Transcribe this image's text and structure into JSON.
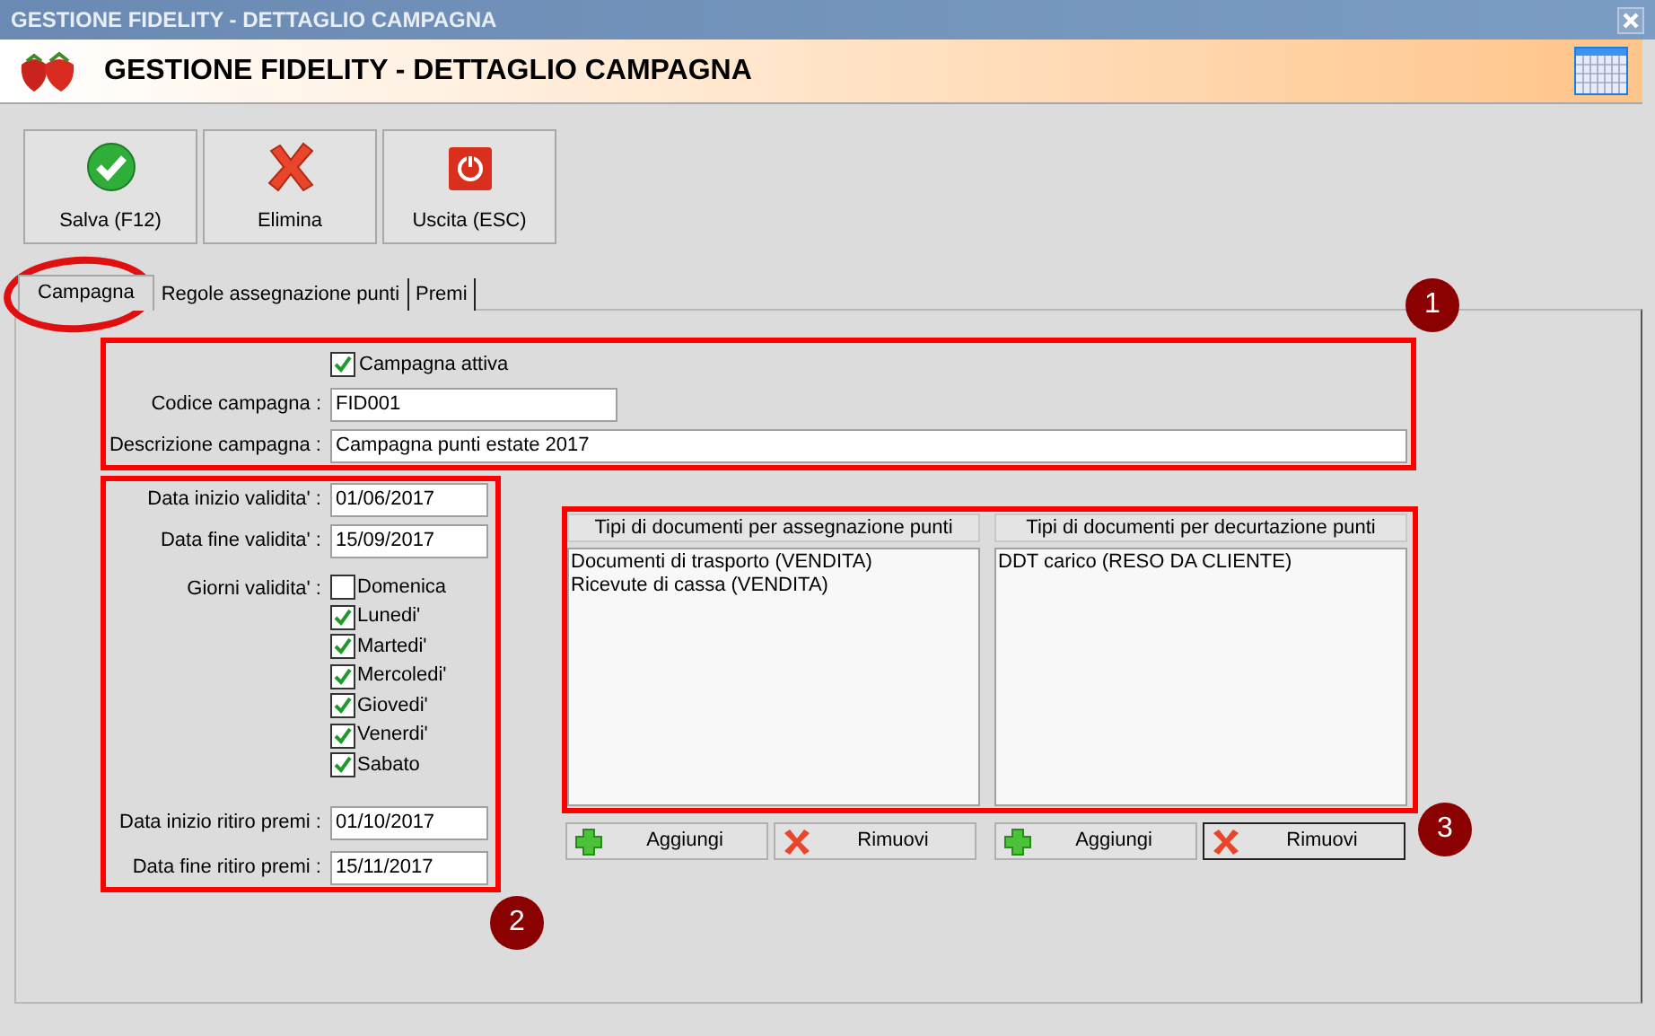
{
  "window": {
    "title": "GESTIONE FIDELITY - DETTAGLIO CAMPAGNA"
  },
  "header": {
    "title": "GESTIONE FIDELITY - DETTAGLIO CAMPAGNA"
  },
  "toolbar": [
    {
      "label": "Salva (F12)",
      "kind": "save"
    },
    {
      "label": "Elimina",
      "kind": "delete"
    },
    {
      "label": "Uscita (ESC)",
      "kind": "exit"
    }
  ],
  "tabs": [
    {
      "label": "Campagna",
      "selected": true
    },
    {
      "label": "Regole assegnazione punti",
      "selected": false
    },
    {
      "label": "Premi",
      "selected": false
    }
  ],
  "campaign": {
    "active": {
      "label": "Campagna attiva",
      "checked": true
    },
    "code": {
      "label": "Codice campagna :",
      "value": "FID001"
    },
    "description": {
      "label": "Descrizione campagna :",
      "value": "Campagna punti estate 2017"
    }
  },
  "validity": {
    "start": {
      "label": "Data inizio validita' :",
      "value": "01/06/2017"
    },
    "end": {
      "label": "Data fine validita' :",
      "value": "15/09/2017"
    },
    "days_label": "Giorni validita' :",
    "days": [
      {
        "label": "Domenica",
        "checked": false
      },
      {
        "label": "Lunedi'",
        "checked": true
      },
      {
        "label": "Martedi'",
        "checked": true
      },
      {
        "label": "Mercoledi'",
        "checked": true
      },
      {
        "label": "Giovedi'",
        "checked": true
      },
      {
        "label": "Venerdi'",
        "checked": true
      },
      {
        "label": "Sabato",
        "checked": true
      }
    ],
    "prize_start": {
      "label": "Data inizio ritiro premi :",
      "value": "01/10/2017"
    },
    "prize_end": {
      "label": "Data fine ritiro premi :",
      "value": "15/11/2017"
    }
  },
  "lists": [
    {
      "header": "Tipi di documenti per assegnazione punti",
      "items": [
        "Documenti di trasporto (VENDITA)",
        "Ricevute di cassa (VENDITA)"
      ],
      "buttons": [
        {
          "label": "Aggiungi",
          "kind": "add",
          "focused": false
        },
        {
          "label": "Rimuovi",
          "kind": "remove",
          "focused": false
        }
      ]
    },
    {
      "header": "Tipi di documenti per decurtazione punti",
      "items": [
        "DDT carico (RESO DA CLIENTE)"
      ],
      "buttons": [
        {
          "label": "Aggiungi",
          "kind": "add",
          "focused": false
        },
        {
          "label": "Rimuovi",
          "kind": "remove",
          "focused": true
        }
      ]
    }
  ],
  "annotations": [
    {
      "label": "1"
    },
    {
      "label": "2"
    },
    {
      "label": "3"
    }
  ]
}
